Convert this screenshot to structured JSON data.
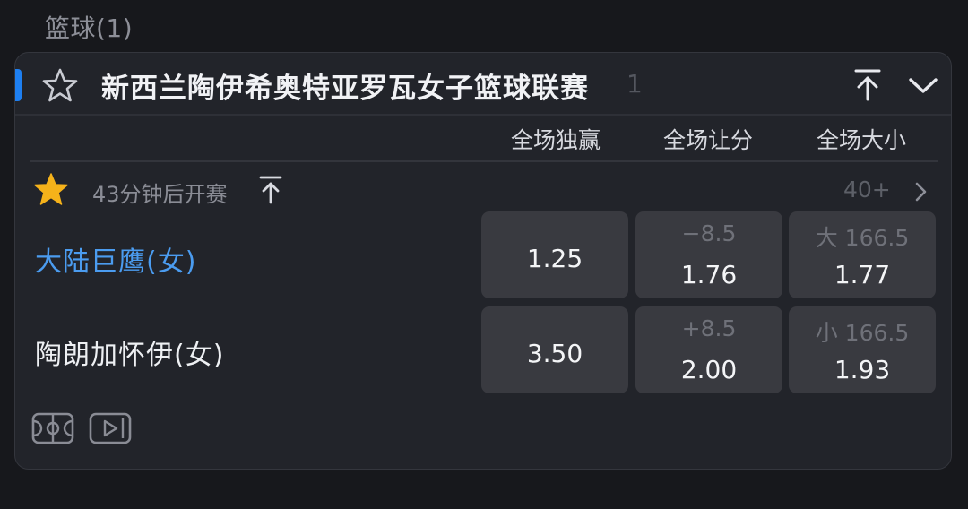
{
  "section": {
    "title": "篮球(1)"
  },
  "league": {
    "name": "新西兰陶伊希奥特亚罗瓦女子篮球联赛",
    "count": "1",
    "accent_color": "#1e7ff0"
  },
  "columns": [
    "全场独赢",
    "全场让分",
    "全场大小"
  ],
  "match": {
    "start_text": "43分钟后开赛",
    "more_markets": "40+",
    "home": {
      "name": "大陆巨鹰(女)",
      "moneyline": "1.25",
      "handicap_line": "−8.5",
      "handicap_odds": "1.76",
      "total_line": "大 166.5",
      "total_odds": "1.77"
    },
    "away": {
      "name": "陶朗加怀伊(女)",
      "moneyline": "3.50",
      "handicap_line": "+8.5",
      "handicap_odds": "2.00",
      "total_line": "小 166.5",
      "total_odds": "1.93"
    }
  },
  "icons": {
    "league_favorite": "star-outline-icon",
    "pin_top": "pin-top-icon",
    "collapse": "chevron-down-icon",
    "match_favorite": "star-filled-icon",
    "favorite_color": "#f5b21a",
    "more": "chevron-right-icon",
    "stats": "court-icon",
    "video": "video-play-icon"
  }
}
